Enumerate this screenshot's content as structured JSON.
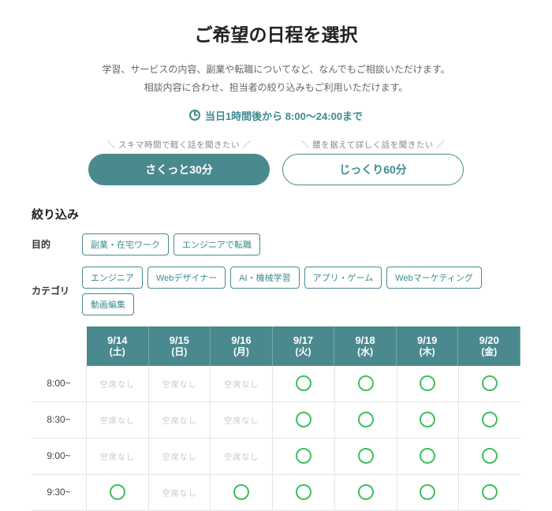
{
  "title": "ご希望の日程を選択",
  "desc_line1": "学習、サービスの内容、副業や転職についてなど、なんでもご相談いただけます。",
  "desc_line2": "相談内容に合わせ、担当者の絞り込みもご利用いただけます。",
  "time_info": "当日1時間後から 8:00〜24:00まで",
  "durations": [
    {
      "hint": "スキマ時間で軽く話を聞きたい",
      "label": "さくっと30分",
      "style": "filled"
    },
    {
      "hint": "腰を据えて詳しく話を聞きたい",
      "label": "じっくり60分",
      "style": "outline"
    }
  ],
  "filter_title": "絞り込み",
  "filters": {
    "goal": {
      "label": "目的",
      "chips": [
        "副業・在宅ワーク",
        "エンジニアで転職"
      ]
    },
    "category": {
      "label": "カテゴリ",
      "chips": [
        "エンジニア",
        "Webデザイナー",
        "AI・機械学習",
        "アプリ・ゲーム",
        "Webマーケティング",
        "動画編集"
      ]
    }
  },
  "days": [
    {
      "date": "9/14",
      "dow": "(土)"
    },
    {
      "date": "9/15",
      "dow": "(日)"
    },
    {
      "date": "9/16",
      "dow": "(月)"
    },
    {
      "date": "9/17",
      "dow": "(火)"
    },
    {
      "date": "9/18",
      "dow": "(水)"
    },
    {
      "date": "9/19",
      "dow": "(木)"
    },
    {
      "date": "9/20",
      "dow": "(金)"
    }
  ],
  "times": [
    "8:00~",
    "8:30~",
    "9:00~",
    "9:30~"
  ],
  "none_label": "空席なし",
  "slots": [
    [
      "none",
      "none",
      "none",
      "open",
      "open",
      "open",
      "open"
    ],
    [
      "none",
      "none",
      "none",
      "open",
      "open",
      "open",
      "open"
    ],
    [
      "none",
      "none",
      "none",
      "open",
      "open",
      "open",
      "open"
    ],
    [
      "open",
      "none",
      "open",
      "open",
      "open",
      "open",
      "open"
    ]
  ]
}
